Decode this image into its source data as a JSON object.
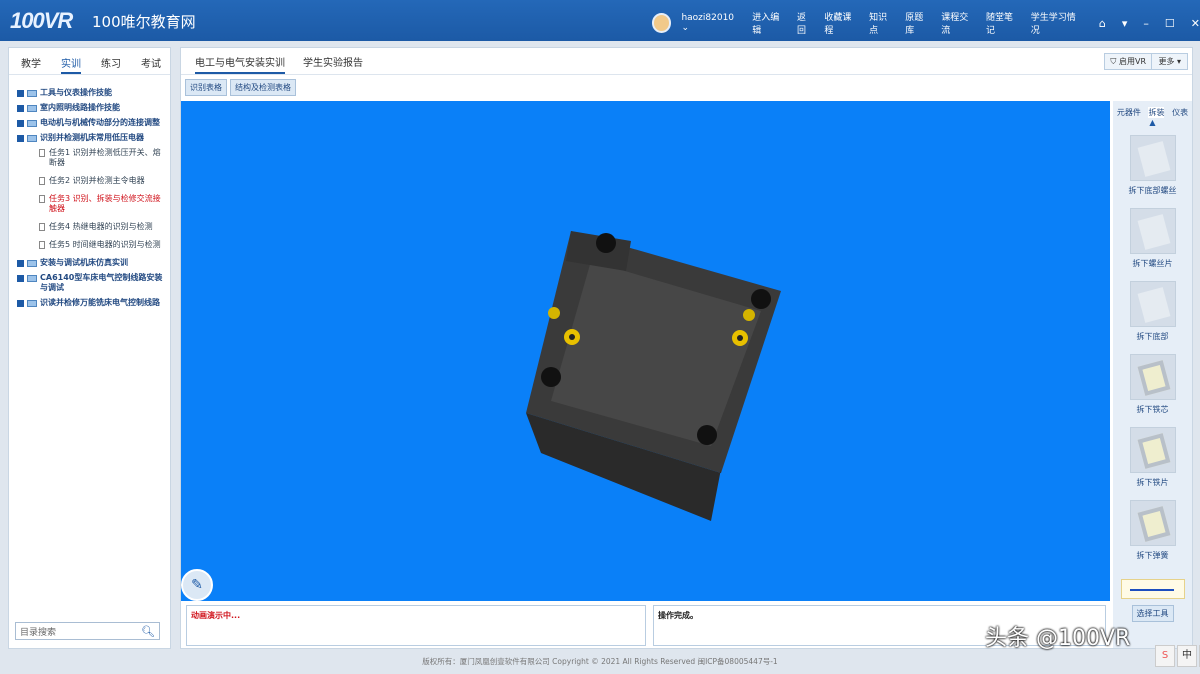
{
  "header": {
    "logo": "100VR",
    "site_name": "100唯尔教育网",
    "username": "haozi82010",
    "nav": [
      "进入编辑",
      "返回",
      "收藏课程",
      "知识点",
      "原题库",
      "课程交流",
      "随堂笔记",
      "学生学习情况"
    ]
  },
  "left": {
    "tabs": [
      "教学",
      "实训",
      "练习",
      "考试"
    ],
    "tree": [
      {
        "label": "工具与仪表操作技能"
      },
      {
        "label": "室内照明线路操作技能"
      },
      {
        "label": "电动机与机械传动部分的连接调整"
      },
      {
        "label": "识别并检测机床常用低压电器",
        "children": [
          "任务1 识别并检测低压开关、熔断器",
          "任务2 识别并检测主令电器",
          "任务3 识别、拆装与检修交流接触器",
          "任务4 热继电器的识别与检测",
          "任务5 时间继电器的识别与检测"
        ]
      },
      {
        "label": "安装与调试机床仿真实训"
      },
      {
        "label": "CA6140型车床电气控制线路安装与调试"
      },
      {
        "label": "识读并检修万能铣床电气控制线路"
      }
    ],
    "search_placeholder": "目录搜索"
  },
  "main": {
    "tabs": [
      "电工与电气安装实训",
      "学生实验报告"
    ],
    "vr_button": "启用VR",
    "more_button": "更多",
    "subtabs": [
      "识别表格",
      "结构及检测表格"
    ],
    "side_tabs": [
      "元器件",
      "拆装",
      "仪表"
    ],
    "steps": [
      "拆下底部螺丝",
      "拆下螺丝片",
      "拆下底部",
      "拆下铁芯",
      "拆下铁片",
      "拆下弹簧"
    ],
    "select_tool": "选择工具",
    "msg_left": "动画演示中...",
    "msg_right": "操作完成。"
  },
  "footer": "版权所有：厦门凤凰创壹软件有限公司   Copyright © 2021   All Rights Reserved   闽ICP备08005447号-1",
  "watermark": "头条 @100VR"
}
